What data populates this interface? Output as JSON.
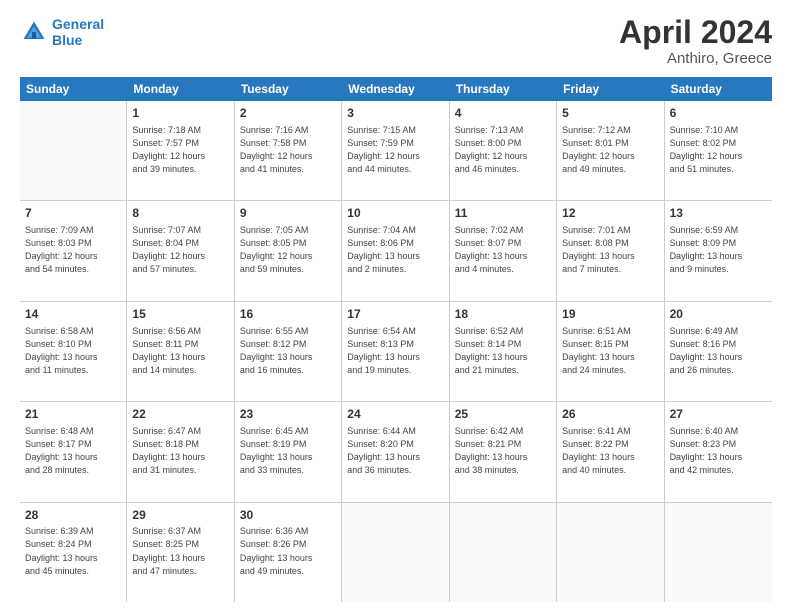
{
  "header": {
    "logo_line1": "General",
    "logo_line2": "Blue",
    "title": "April 2024",
    "subtitle": "Anthiro, Greece"
  },
  "days": [
    "Sunday",
    "Monday",
    "Tuesday",
    "Wednesday",
    "Thursday",
    "Friday",
    "Saturday"
  ],
  "weeks": [
    [
      {
        "day": "",
        "info": ""
      },
      {
        "day": "1",
        "info": "Sunrise: 7:18 AM\nSunset: 7:57 PM\nDaylight: 12 hours\nand 39 minutes."
      },
      {
        "day": "2",
        "info": "Sunrise: 7:16 AM\nSunset: 7:58 PM\nDaylight: 12 hours\nand 41 minutes."
      },
      {
        "day": "3",
        "info": "Sunrise: 7:15 AM\nSunset: 7:59 PM\nDaylight: 12 hours\nand 44 minutes."
      },
      {
        "day": "4",
        "info": "Sunrise: 7:13 AM\nSunset: 8:00 PM\nDaylight: 12 hours\nand 46 minutes."
      },
      {
        "day": "5",
        "info": "Sunrise: 7:12 AM\nSunset: 8:01 PM\nDaylight: 12 hours\nand 49 minutes."
      },
      {
        "day": "6",
        "info": "Sunrise: 7:10 AM\nSunset: 8:02 PM\nDaylight: 12 hours\nand 51 minutes."
      }
    ],
    [
      {
        "day": "7",
        "info": "Sunrise: 7:09 AM\nSunset: 8:03 PM\nDaylight: 12 hours\nand 54 minutes."
      },
      {
        "day": "8",
        "info": "Sunrise: 7:07 AM\nSunset: 8:04 PM\nDaylight: 12 hours\nand 57 minutes."
      },
      {
        "day": "9",
        "info": "Sunrise: 7:05 AM\nSunset: 8:05 PM\nDaylight: 12 hours\nand 59 minutes."
      },
      {
        "day": "10",
        "info": "Sunrise: 7:04 AM\nSunset: 8:06 PM\nDaylight: 13 hours\nand 2 minutes."
      },
      {
        "day": "11",
        "info": "Sunrise: 7:02 AM\nSunset: 8:07 PM\nDaylight: 13 hours\nand 4 minutes."
      },
      {
        "day": "12",
        "info": "Sunrise: 7:01 AM\nSunset: 8:08 PM\nDaylight: 13 hours\nand 7 minutes."
      },
      {
        "day": "13",
        "info": "Sunrise: 6:59 AM\nSunset: 8:09 PM\nDaylight: 13 hours\nand 9 minutes."
      }
    ],
    [
      {
        "day": "14",
        "info": "Sunrise: 6:58 AM\nSunset: 8:10 PM\nDaylight: 13 hours\nand 11 minutes."
      },
      {
        "day": "15",
        "info": "Sunrise: 6:56 AM\nSunset: 8:11 PM\nDaylight: 13 hours\nand 14 minutes."
      },
      {
        "day": "16",
        "info": "Sunrise: 6:55 AM\nSunset: 8:12 PM\nDaylight: 13 hours\nand 16 minutes."
      },
      {
        "day": "17",
        "info": "Sunrise: 6:54 AM\nSunset: 8:13 PM\nDaylight: 13 hours\nand 19 minutes."
      },
      {
        "day": "18",
        "info": "Sunrise: 6:52 AM\nSunset: 8:14 PM\nDaylight: 13 hours\nand 21 minutes."
      },
      {
        "day": "19",
        "info": "Sunrise: 6:51 AM\nSunset: 8:15 PM\nDaylight: 13 hours\nand 24 minutes."
      },
      {
        "day": "20",
        "info": "Sunrise: 6:49 AM\nSunset: 8:16 PM\nDaylight: 13 hours\nand 26 minutes."
      }
    ],
    [
      {
        "day": "21",
        "info": "Sunrise: 6:48 AM\nSunset: 8:17 PM\nDaylight: 13 hours\nand 28 minutes."
      },
      {
        "day": "22",
        "info": "Sunrise: 6:47 AM\nSunset: 8:18 PM\nDaylight: 13 hours\nand 31 minutes."
      },
      {
        "day": "23",
        "info": "Sunrise: 6:45 AM\nSunset: 8:19 PM\nDaylight: 13 hours\nand 33 minutes."
      },
      {
        "day": "24",
        "info": "Sunrise: 6:44 AM\nSunset: 8:20 PM\nDaylight: 13 hours\nand 36 minutes."
      },
      {
        "day": "25",
        "info": "Sunrise: 6:42 AM\nSunset: 8:21 PM\nDaylight: 13 hours\nand 38 minutes."
      },
      {
        "day": "26",
        "info": "Sunrise: 6:41 AM\nSunset: 8:22 PM\nDaylight: 13 hours\nand 40 minutes."
      },
      {
        "day": "27",
        "info": "Sunrise: 6:40 AM\nSunset: 8:23 PM\nDaylight: 13 hours\nand 42 minutes."
      }
    ],
    [
      {
        "day": "28",
        "info": "Sunrise: 6:39 AM\nSunset: 8:24 PM\nDaylight: 13 hours\nand 45 minutes."
      },
      {
        "day": "29",
        "info": "Sunrise: 6:37 AM\nSunset: 8:25 PM\nDaylight: 13 hours\nand 47 minutes."
      },
      {
        "day": "30",
        "info": "Sunrise: 6:36 AM\nSunset: 8:26 PM\nDaylight: 13 hours\nand 49 minutes."
      },
      {
        "day": "",
        "info": ""
      },
      {
        "day": "",
        "info": ""
      },
      {
        "day": "",
        "info": ""
      },
      {
        "day": "",
        "info": ""
      }
    ]
  ]
}
